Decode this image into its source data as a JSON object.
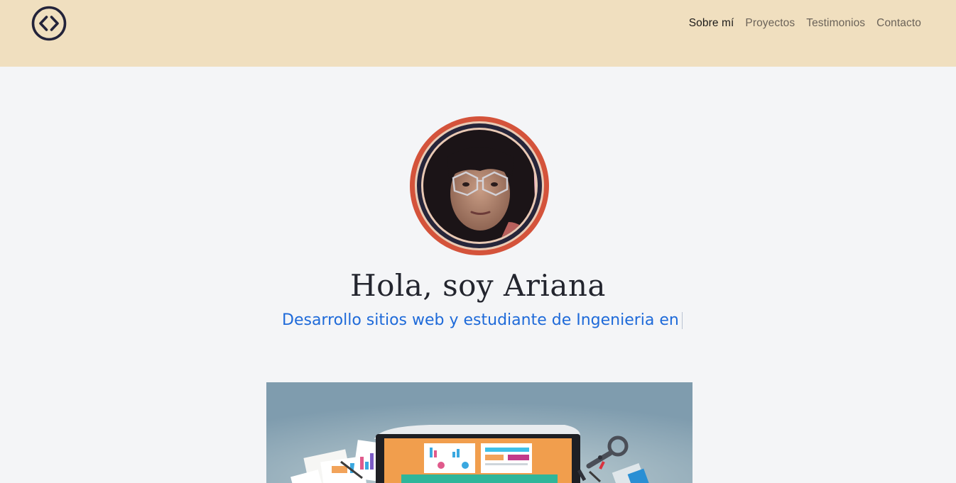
{
  "nav": {
    "logo_icon": "code-brackets-icon",
    "links": [
      {
        "label": "Sobre mí",
        "active": true
      },
      {
        "label": "Proyectos",
        "active": false
      },
      {
        "label": "Testimonios",
        "active": false
      },
      {
        "label": "Contacto",
        "active": false
      }
    ]
  },
  "hero": {
    "title": "Hola, soy Ariana",
    "subtitle": "Desarrollo sitios web y estudiante de Ingenieria en",
    "avatar_icon": "profile-photo"
  },
  "colors": {
    "navbar_bg": "#f0dfbf",
    "page_bg": "#f4f5f7",
    "accent_blue": "#1e6ad9",
    "avatar_ring": "#d4533b",
    "dark": "#23252e"
  }
}
